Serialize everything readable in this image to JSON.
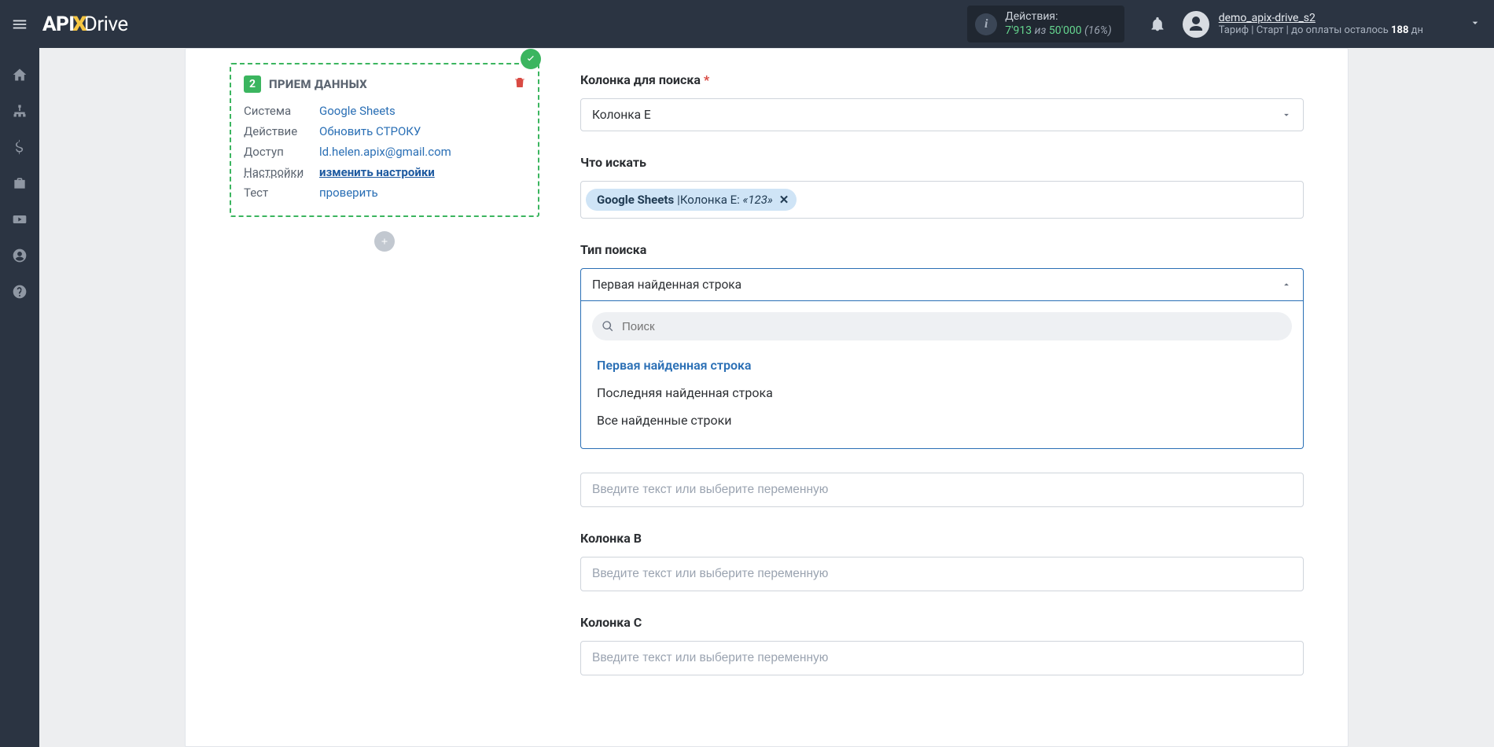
{
  "header": {
    "logo": {
      "api": "API",
      "x": "X",
      "drive": "Drive"
    },
    "actions": {
      "title": "Действия:",
      "current": "7'913",
      "sep": "из",
      "limit": "50'000",
      "percent": "(16%)"
    },
    "user": {
      "name": "demo_apix-drive_s2",
      "tariff_prefix": "Тариф |",
      "tariff_name": "Старт",
      "tariff_sep": "|",
      "pay_text": "до оплаты осталось",
      "days": "188",
      "days_suffix": "дн"
    }
  },
  "step_card": {
    "number": "2",
    "title": "ПРИЕМ ДАННЫХ",
    "rows": {
      "system_k": "Система",
      "system_v": "Google Sheets",
      "action_k": "Действие",
      "action_v": "Обновить СТРОКУ",
      "access_k": "Доступ",
      "access_v": "ld.helen.apix@gmail.com",
      "settings_k": "Настройки",
      "settings_v": "изменить настройки",
      "test_k": "Тест",
      "test_v": "проверить"
    }
  },
  "form": {
    "col_search": {
      "label": "Колонка для поиска",
      "value": "Колонка E"
    },
    "what_search": {
      "label": "Что искать",
      "chip_source": "Google Sheets",
      "chip_sep": " | ",
      "chip_field": "Колонка E:",
      "chip_value": "«123»"
    },
    "search_type": {
      "label": "Тип поиска",
      "value": "Первая найденная строка",
      "search_placeholder": "Поиск",
      "options": [
        "Первая найденная строка",
        "Последняя найденная строка",
        "Все найденные строки"
      ]
    },
    "placeholder_text": "Введите текст или выберите переменную",
    "col_b_label": "Колонка B",
    "col_c_label": "Колонка C"
  }
}
